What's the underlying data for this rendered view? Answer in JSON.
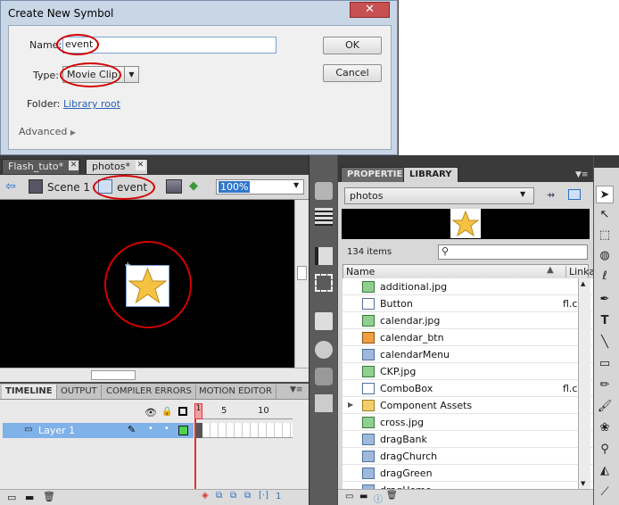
{
  "dialog": {
    "title": "Create New Symbol",
    "close_glyph": "✕",
    "name_label": "Name:",
    "name_value": "event",
    "type_label": "Type:",
    "type_value": "Movie Clip",
    "folder_label": "Folder:",
    "folder_value": "Library root",
    "advanced_label": "Advanced",
    "ok_label": "OK",
    "cancel_label": "Cancel"
  },
  "document_tabs": [
    {
      "label": "Flash_tuto*"
    },
    {
      "label": "photos*"
    }
  ],
  "editbar": {
    "scene_label": "Scene 1",
    "symbol_label": "event",
    "zoom_value": "100%"
  },
  "timeline": {
    "tabs": [
      "TIMELINE",
      "OUTPUT",
      "COMPILER ERRORS",
      "MOTION EDITOR"
    ],
    "frame_numbers": [
      "1",
      "5",
      "10"
    ],
    "layer_name": "Layer 1",
    "current_frame": "1"
  },
  "library": {
    "tabs": [
      "PROPERTIES",
      "LIBRARY"
    ],
    "document_select": "photos",
    "item_count": "134 items",
    "col_name": "Name",
    "col_linkage": "Linka",
    "items": [
      {
        "name": "additional.jpg",
        "linkage": "",
        "icon": "bitmap-icon"
      },
      {
        "name": "Button",
        "linkage": "fl.c",
        "icon": "component-icon"
      },
      {
        "name": "calendar.jpg",
        "linkage": "",
        "icon": "bitmap-icon"
      },
      {
        "name": "calendar_btn",
        "linkage": "",
        "icon": "button-symbol-icon"
      },
      {
        "name": "calendarMenu",
        "linkage": "",
        "icon": "movieclip-icon"
      },
      {
        "name": "CKP.jpg",
        "linkage": "",
        "icon": "bitmap-icon"
      },
      {
        "name": "ComboBox",
        "linkage": "fl.c",
        "icon": "component-icon"
      },
      {
        "name": "Component Assets",
        "linkage": "",
        "icon": "folder-icon"
      },
      {
        "name": "cross.jpg",
        "linkage": "",
        "icon": "bitmap-icon"
      },
      {
        "name": "dragBank",
        "linkage": "",
        "icon": "movieclip-icon"
      },
      {
        "name": "dragChurch",
        "linkage": "",
        "icon": "movieclip-icon"
      },
      {
        "name": "dragGreen",
        "linkage": "",
        "icon": "movieclip-icon"
      },
      {
        "name": "dragHome",
        "linkage": "",
        "icon": "movieclip-icon"
      }
    ]
  },
  "colors": {
    "annotation_red": "#d40000",
    "star_fill": "#f5c242",
    "selection_blue": "#7fb2e8"
  }
}
